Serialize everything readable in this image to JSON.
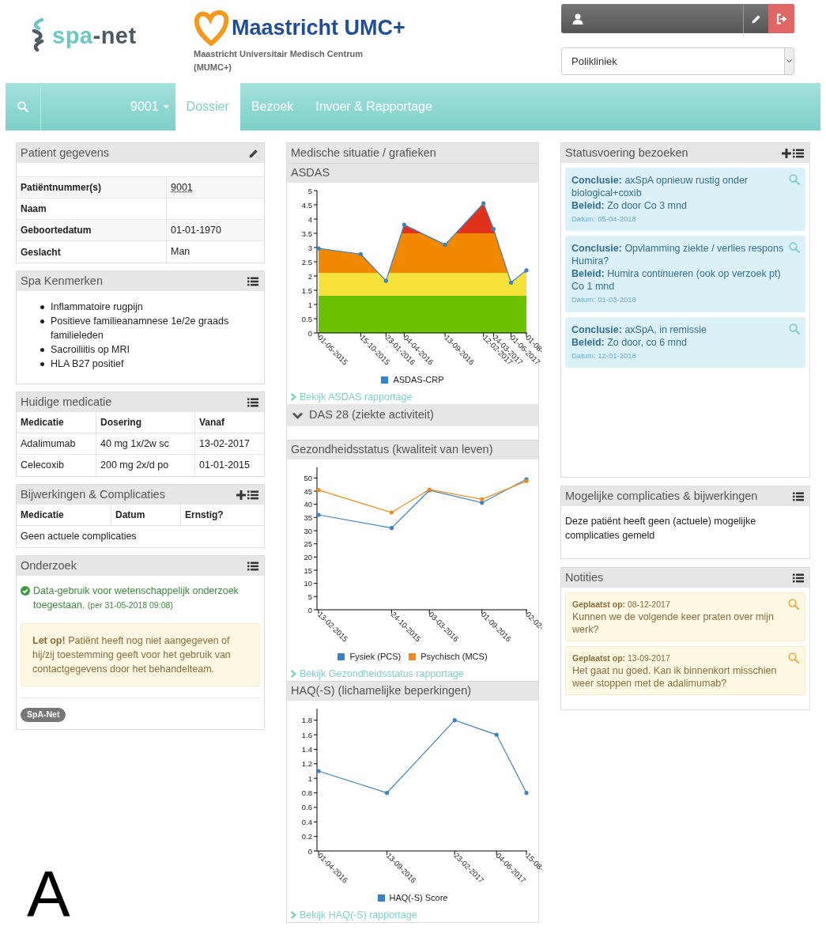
{
  "header": {
    "logo": {
      "prefix": "spa",
      "suffix": "-net"
    },
    "hospital": {
      "name": "Maastricht UMC+",
      "subtitle": "Maastricht Universitair Medisch Centrum (MUMC+)"
    },
    "location_select": {
      "value": "Polikliniek"
    }
  },
  "nav": {
    "patient": "9001",
    "tabs": [
      {
        "label": "Dossier",
        "selected": true
      },
      {
        "label": "Bezoek",
        "selected": false
      },
      {
        "label": "Invoer & Rapportage",
        "selected": false
      }
    ]
  },
  "patient_card": {
    "title": "Patient gegevens",
    "rows": [
      {
        "label": "Patiëntnummer(s)",
        "value": "9001"
      },
      {
        "label": "Naam"
      },
      {
        "label": "Geboortedatum",
        "value": "01-01-1970"
      },
      {
        "label": "Geslacht",
        "value": "Man"
      }
    ]
  },
  "spa_card": {
    "title": "Spa Kenmerken",
    "items": [
      "Inflammatoire rugpijn",
      "Positieve familieanamnese 1e/2e graads familieleden",
      "Sacroiliitis op MRI",
      "HLA B27 positief"
    ]
  },
  "medication_card": {
    "title": "Huidige medicatie",
    "columns": [
      "Medicatie",
      "Dosering",
      "Vanaf"
    ],
    "rows": [
      [
        "Adalimumab",
        "40 mg 1x/2w sc",
        "13-02-2017"
      ],
      [
        "Celecoxib",
        "200 mg 2x/d po",
        "01-01-2015"
      ]
    ]
  },
  "complications_card": {
    "title": "Bijwerkingen & Complicaties",
    "columns": [
      "Medicatie",
      "Datum",
      "Ernstig?"
    ],
    "empty_text": "Geen actuele complicaties"
  },
  "research_card": {
    "title": "Onderzoek",
    "consent": {
      "text": "Data-gebruik voor wetenschappelijk onderzoek toegestaan.",
      "note": "(per 31-05-2018 09:08)"
    },
    "warning": "**Let op!** Patiënt heeft nog niet aangegeven of hij/zij toestemming geeft voor het gebruik van contactgegevens door het behandelteam.",
    "tag": "SpA-Net"
  },
  "panel_label": "A",
  "medical": {
    "title": "Medische situatie / grafieken",
    "sections": [
      {
        "kind": "chart",
        "title": "ASDAS",
        "link": "Bekijk ASDAS rapportage",
        "chart_data": {
          "type": "area",
          "legend": "bottom",
          "categories": [
            "01-05-2015",
            "15-10-2015",
            "23-01-2016",
            "04-04-2016",
            "13-09-2016",
            "12-02-2017",
            "24-03-2017",
            "01-06-2017",
            "01-08-"
          ],
          "series": [
            {
              "name": "ASDAS-CRP",
              "color": "#3b82c4",
              "values": [
                2.97,
                2.77,
                1.83,
                3.8,
                3.1,
                4.55,
                3.65,
                1.77,
                2.2
              ]
            }
          ],
          "ylim": [
            0,
            5
          ],
          "yticks": [
            0,
            0.5,
            1,
            1.5,
            2,
            2.5,
            3,
            3.5,
            4,
            4.5,
            5
          ]
        }
      },
      {
        "kind": "collapsible",
        "title": "DAS 28 (ziekte activiteit)",
        "expanded": false
      },
      {
        "kind": "chart",
        "title": "Gezondheidsstatus (kwaliteit van leven)",
        "link": "Bekijk Gezondheidsstatus rapportage",
        "chart_data": {
          "type": "line",
          "legend": "bottom",
          "categories": [
            "13-02-2015",
            "24-10-2015",
            "03-03-2016",
            "01-09-2016",
            "02-02-"
          ],
          "series": [
            {
              "name": "Fysiek (PCS)",
              "color": "#3b82c4",
              "values": [
                36,
                31,
                45.3,
                40.6,
                49.5
              ]
            },
            {
              "name": "Psychisch (MCS)",
              "color": "#f28a1c",
              "values": [
                45.4,
                36.9,
                45.6,
                41.9,
                48.8
              ]
            }
          ],
          "ylim": [
            0,
            54
          ],
          "yticks": [
            0,
            5,
            10,
            15,
            20,
            25,
            30,
            35,
            40,
            45,
            50
          ]
        }
      },
      {
        "kind": "chart",
        "title": "HAQ(-S) (lichamelijke beperkingen)",
        "link": "Bekijk HAQ(-S) rapportage",
        "chart_data": {
          "type": "line",
          "legend": "bottom",
          "categories": [
            "01-04-2016",
            "13-09-2016",
            "23-02-2017",
            "04-06-2017",
            "15-08-"
          ],
          "series": [
            {
              "name": "HAQ(-S) Score",
              "color": "#3b82c4",
              "values": [
                1.1,
                0.8,
                1.8,
                1.6,
                0.8
              ]
            }
          ],
          "ylim": [
            0,
            1.96
          ],
          "yticks": [
            0,
            0.2,
            0.4,
            0.6,
            0.8,
            1,
            1.2,
            1.4,
            1.6,
            1.8
          ]
        }
      }
    ]
  },
  "visits_card": {
    "title": "Statusvoering bezoeken",
    "visits": [
      {
        "conclusion": "**Conclusie:** axSpA opnieuw rustig onder biological+coxib",
        "policy": "**Beleid:** Zo door Co 3 mnd",
        "date": "Datum: 05-04-2018"
      },
      {
        "conclusion": "**Conclusie:** Opvlamming ziekte / verlies respons Humira?",
        "policy": "**Beleid:** Humira continueren (ook op verzoek pt) Co 1 mnd",
        "date": "Datum: 01-03-2018"
      },
      {
        "conclusion": "**Conclusie:** axSpA, in remissie",
        "policy": "**Beleid:** Zo door, co 6 mnd",
        "date": "Datum: 12-01-2018"
      }
    ]
  },
  "possible_complications_card": {
    "title": "Mogelijke complicaties & bijwerkingen",
    "text": "Deze patiënt heeft geen (actuele) mogelijke complicaties gemeld"
  },
  "notes_card": {
    "title": "Notities",
    "notes": [
      {
        "posted": "**Geplaatst op:** 08-12-2017",
        "text": "Kunnen we de volgende keer praten over mijn werk?"
      },
      {
        "posted": "**Geplaatst op:** 13-09-2017",
        "text": "Het gaat nu goed. Kan ik binnenkort misschien weer stoppen met de adalimumab?"
      }
    ]
  }
}
